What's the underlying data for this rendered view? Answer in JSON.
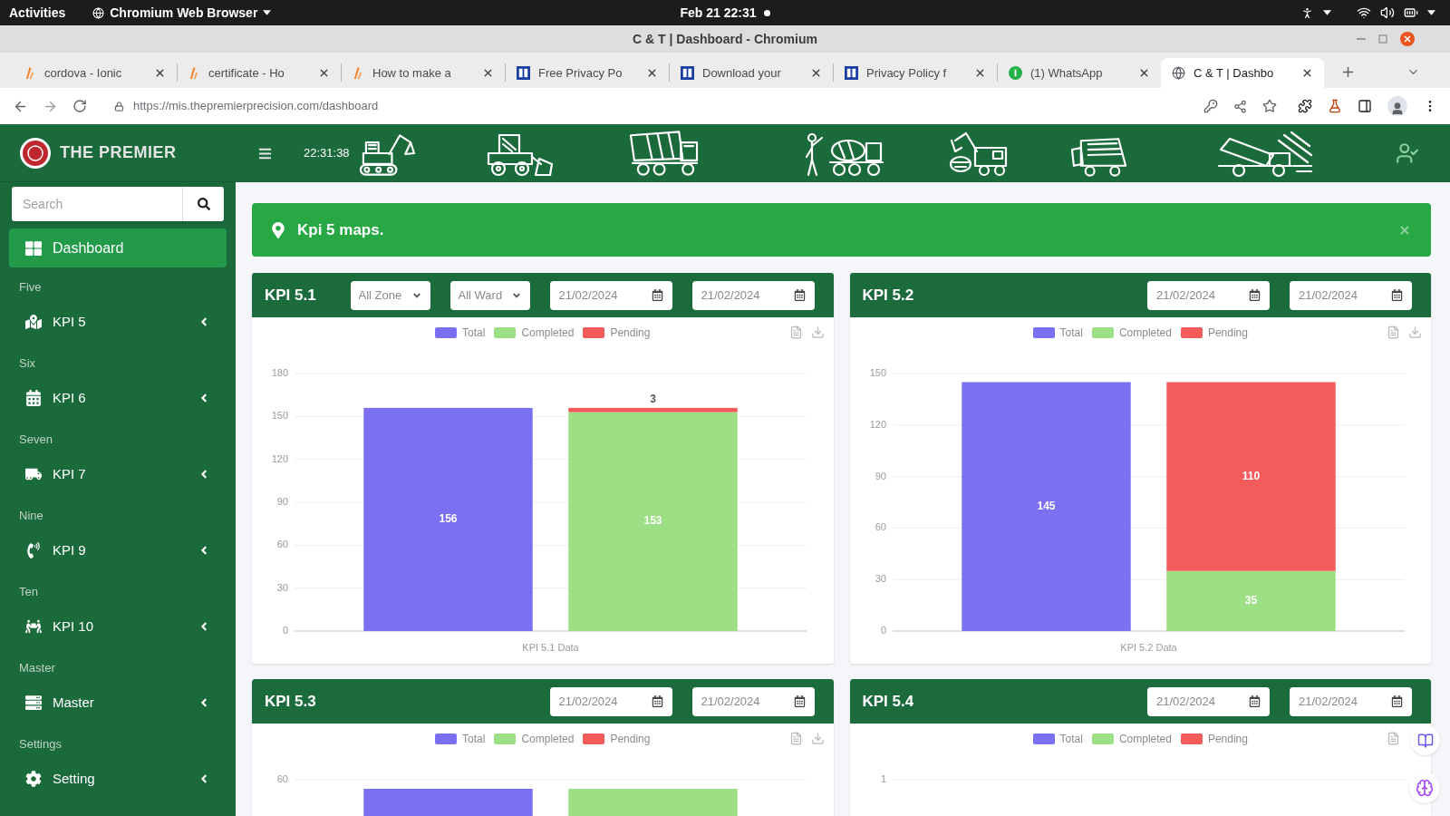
{
  "system_bar": {
    "activities": "Activities",
    "app_menu": "Chromium Web Browser",
    "clock": "Feb 21 22:31"
  },
  "window": {
    "title": "C & T | Dashboard - Chromium"
  },
  "tabs": [
    {
      "title": "cordova - Ionic",
      "kind": "flame",
      "selected": false
    },
    {
      "title": "certificate - Ho",
      "kind": "flame",
      "selected": false
    },
    {
      "title": "How to make a",
      "kind": "flame",
      "selected": false
    },
    {
      "title": "Free Privacy Po",
      "kind": "square",
      "selected": false
    },
    {
      "title": "Download your",
      "kind": "square",
      "selected": false
    },
    {
      "title": "Privacy Policy f",
      "kind": "square",
      "selected": false
    },
    {
      "title": "(1) WhatsApp",
      "kind": "dot",
      "selected": false
    },
    {
      "title": "C & T | Dashbo",
      "kind": "globe",
      "selected": true
    }
  ],
  "toolbar": {
    "url": "https://mis.thepremierprecision.com/dashboard"
  },
  "sidebar": {
    "brand": "THE PREMIER",
    "search": {
      "placeholder": "Search"
    },
    "dashboard": {
      "label": "Dashboard",
      "selected": true
    },
    "sections": [
      {
        "heading": "Five",
        "item": {
          "label": "KPI 5",
          "selected": false,
          "expanded": false
        }
      },
      {
        "heading": "Six",
        "item": {
          "label": "KPI 6",
          "selected": false,
          "expanded": false
        }
      },
      {
        "heading": "Seven",
        "item": {
          "label": "KPI 7",
          "selected": false,
          "expanded": false
        }
      },
      {
        "heading": "Nine",
        "item": {
          "label": "KPI 9",
          "selected": false,
          "expanded": false
        }
      },
      {
        "heading": "Ten",
        "item": {
          "label": "KPI 10",
          "selected": false,
          "expanded": false
        }
      },
      {
        "heading": "Master",
        "item": {
          "label": "Master",
          "selected": false,
          "expanded": false
        }
      },
      {
        "heading": "Settings",
        "item": {
          "label": "Setting",
          "selected": false,
          "expanded": false
        }
      }
    ]
  },
  "header": {
    "time": "22:31:38"
  },
  "alert": {
    "message": "Kpi 5 maps."
  },
  "cards": [
    {
      "kind": "chart",
      "title": "KPI 5.1",
      "filters": [
        {
          "kind": "select",
          "value": "All Zone"
        },
        {
          "kind": "select",
          "value": "All Ward"
        },
        {
          "kind": "date",
          "value": "21/02/2024"
        },
        {
          "kind": "date",
          "value": "21/02/2024"
        }
      ],
      "chart_data": {
        "type": "bar",
        "xlabel": "KPI 5.1 Data",
        "series": [
          {
            "name": "Total",
            "color": "#7b70f2",
            "values": [
              156,
              null
            ]
          },
          {
            "name": "Completed",
            "color": "#9ddf84",
            "values": [
              null,
              153
            ]
          },
          {
            "name": "Pending",
            "color": "#f45b5b",
            "values": [
              null,
              3
            ]
          }
        ],
        "ylim": [
          0,
          180
        ],
        "yticks": [
          0,
          30,
          60,
          90,
          120,
          150,
          180
        ],
        "grid": true,
        "stacked": true,
        "data_labels": true
      }
    },
    {
      "kind": "chart",
      "title": "KPI 5.2",
      "filters": [
        {
          "kind": "date",
          "value": "21/02/2024"
        },
        {
          "kind": "date",
          "value": "21/02/2024"
        }
      ],
      "chart_data": {
        "type": "bar",
        "xlabel": "KPI 5.2 Data",
        "series": [
          {
            "name": "Total",
            "color": "#7b70f2",
            "values": [
              145,
              null
            ]
          },
          {
            "name": "Completed",
            "color": "#9ddf84",
            "values": [
              null,
              35
            ]
          },
          {
            "name": "Pending",
            "color": "#f45b5b",
            "values": [
              null,
              110
            ]
          }
        ],
        "ylim": [
          0,
          150
        ],
        "yticks": [
          0,
          30,
          60,
          90,
          120,
          150
        ],
        "grid": true,
        "stacked": true,
        "data_labels": true
      }
    },
    {
      "kind": "bars",
      "title": "KPI 5.3",
      "filters": [
        {
          "kind": "date",
          "value": "21/02/2024"
        },
        {
          "kind": "date",
          "value": "21/02/2024"
        }
      ],
      "legend": [
        {
          "label": "Total",
          "color": "#7b70f2"
        },
        {
          "label": "Completed",
          "color": "#9ddf84"
        },
        {
          "label": "Pending",
          "color": "#f45b5b"
        }
      ],
      "top_tick": "60"
    },
    {
      "kind": "blank",
      "title": "KPI 5.4",
      "filters": [
        {
          "kind": "date",
          "value": "21/02/2024"
        },
        {
          "kind": "date",
          "value": "21/02/2024"
        }
      ],
      "legend": [
        {
          "label": "Total",
          "color": "#7b70f2"
        },
        {
          "label": "Completed",
          "color": "#9ddf84"
        },
        {
          "label": "Pending",
          "color": "#f45b5b"
        }
      ],
      "top_tick": "1"
    }
  ]
}
